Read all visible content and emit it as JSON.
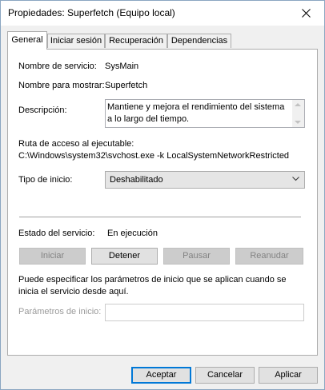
{
  "window": {
    "title": "Propiedades: Superfetch (Equipo local)"
  },
  "tabs": [
    {
      "label": "General",
      "active": true
    },
    {
      "label": "Iniciar sesión",
      "active": false
    },
    {
      "label": "Recuperación",
      "active": false
    },
    {
      "label": "Dependencias",
      "active": false
    }
  ],
  "general": {
    "service_name_label": "Nombre de servicio:",
    "service_name": "SysMain",
    "display_name_label": "Nombre para mostrar:",
    "display_name": "Superfetch",
    "description_label": "Descripción:",
    "description": "Mantiene y mejora el rendimiento del sistema a lo largo del tiempo.",
    "path_label": "Ruta de acceso al ejecutable:",
    "path": "C:\\Windows\\system32\\svchost.exe -k LocalSystemNetworkRestricted",
    "startup_type_label": "Tipo de inicio:",
    "startup_type": "Deshabilitado",
    "status_label": "Estado del servicio:",
    "status": "En ejecución",
    "service_buttons": {
      "start": "Iniciar",
      "stop": "Detener",
      "pause": "Pausar",
      "resume": "Reanudar"
    },
    "params_hint": "Puede especificar los parámetros de inicio que se aplican cuando se inicia el servicio desde aquí.",
    "params_label": "Parámetros de inicio:",
    "params_value": ""
  },
  "footer": {
    "ok": "Aceptar",
    "cancel": "Cancelar",
    "apply": "Aplicar"
  },
  "colors": {
    "accent": "#0078d7",
    "window_border": "#8aa6c1"
  },
  "icons": {
    "close": "close-icon",
    "description_scroll_up": "scroll-up-arrow-icon",
    "description_scroll_down": "scroll-down-arrow-icon",
    "startup_dropdown": "chevron-down-icon"
  }
}
